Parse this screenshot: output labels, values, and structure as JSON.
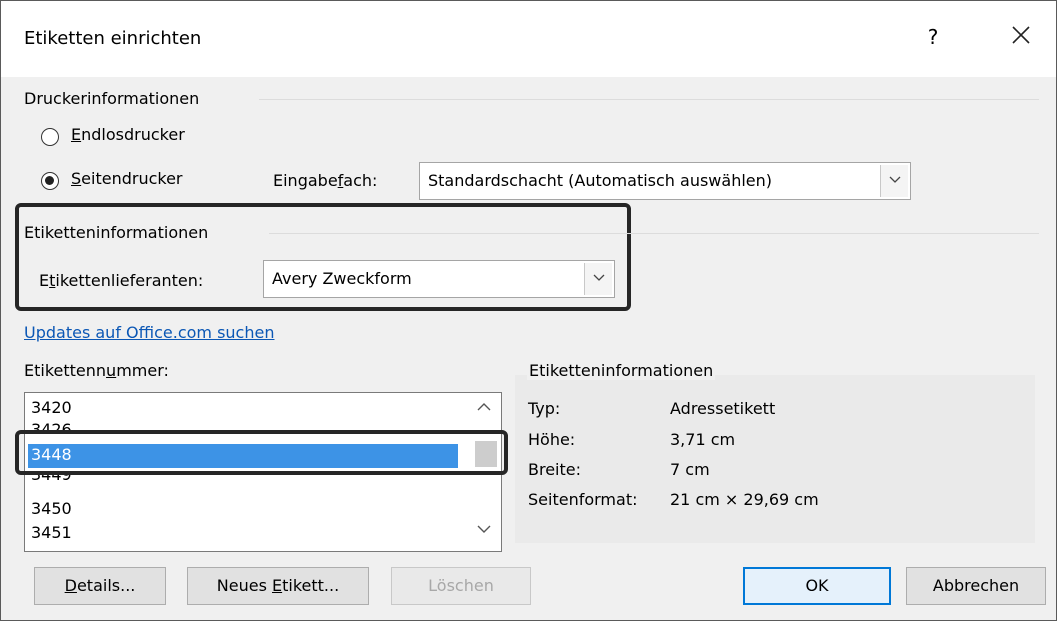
{
  "window": {
    "title": "Etiketten einrichten",
    "help_label": "?"
  },
  "printer_info": {
    "heading": "Druckerinformationen",
    "continuous": {
      "pre": "",
      "u": "E",
      "post": "ndlosdrucker",
      "checked": false
    },
    "page": {
      "pre": "",
      "u": "S",
      "post": "eitendrucker",
      "checked": true
    },
    "tray_label": {
      "pre": "Eingabe",
      "u": "f",
      "post": "ach:"
    },
    "tray_value": "Standardschacht (Automatisch auswählen)"
  },
  "label_info": {
    "heading": "Etiketteninformationen",
    "vendor_label": {
      "pre": "E",
      "u": "t",
      "post": "ikettenlieferanten:"
    },
    "vendor_value": "Avery Zweckform"
  },
  "updates_link": "Updates auf Office.com suchen",
  "product_number": {
    "label": {
      "pre": "Etikettenn",
      "u": "u",
      "post": "mmer:"
    },
    "items": [
      "3420",
      "3426",
      "3448",
      "3449",
      "3450",
      "3451"
    ],
    "selected": "3448"
  },
  "details_box": {
    "heading": "Etiketteninformationen",
    "rows": [
      {
        "key": "Typ:",
        "value": "Adressetikett"
      },
      {
        "key": "Höhe:",
        "value": "3,71 cm"
      },
      {
        "key": "Breite:",
        "value": "7 cm"
      },
      {
        "key": "Seitenformat:",
        "value": "21 cm × 29,69 cm"
      }
    ]
  },
  "buttons": {
    "details": {
      "pre": "",
      "u": "D",
      "post": "etails..."
    },
    "new_label": {
      "pre": "Neues ",
      "u": "E",
      "post": "tikett..."
    },
    "delete": "Löschen",
    "ok": "OK",
    "cancel": "Abbrechen"
  },
  "colors": {
    "accent": "#0078d7",
    "selection": "#3d93e6",
    "link": "#0b57b5",
    "highlight_box": "#262626"
  }
}
